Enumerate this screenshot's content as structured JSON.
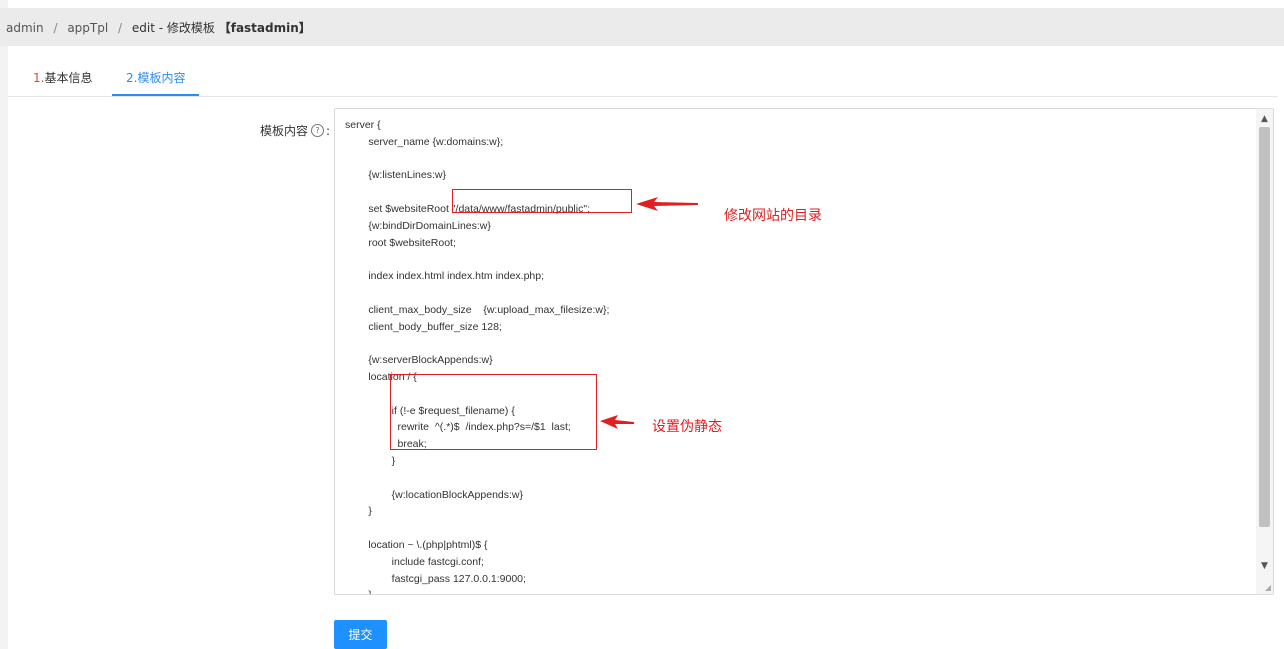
{
  "breadcrumb": {
    "item1": "admin",
    "item2": "appTpl",
    "current_prefix": "edit - 修改模板",
    "current_name": "【fastadmin】",
    "separator": "/"
  },
  "tabs": [
    {
      "num": "1.",
      "label": "基本信息",
      "active": false
    },
    {
      "num": "2.",
      "label": "模板内容",
      "active": true
    }
  ],
  "form": {
    "content_label": "模板内容",
    "help_icon": "?",
    "label_suffix": ":",
    "template_content": "server {\n        server_name {w:domains:w};\n\n        {w:listenLines:w}\n\n        set $websiteRoot \"/data/www/fastadmin/public\";\n        {w:bindDirDomainLines:w}\n        root $websiteRoot;\n\n        index index.html index.htm index.php;\n\n        client_max_body_size    {w:upload_max_filesize:w};\n        client_body_buffer_size 128;\n\n        {w:serverBlockAppends:w}\n        location / {\n\n                if (!-e $request_filename) {\n                  rewrite  ^(.*)$  /index.php?s=/$1  last;\n                  break;\n                }\n\n                {w:locationBlockAppends:w}\n        }\n\n        location ~ \\.(php|phtml)$ {\n                include fastcgi.conf;\n                fastcgi_pass 127.0.0.1:9000;\n        }",
    "submit_label": "提交"
  },
  "annotations": [
    {
      "text": "修改网站的目录",
      "color": "#e02020"
    },
    {
      "text": "设置伪静态",
      "color": "#e02020"
    }
  ],
  "colors": {
    "accent": "#2d8cf0",
    "button": "#1e90ff",
    "annotation": "#e02020"
  }
}
